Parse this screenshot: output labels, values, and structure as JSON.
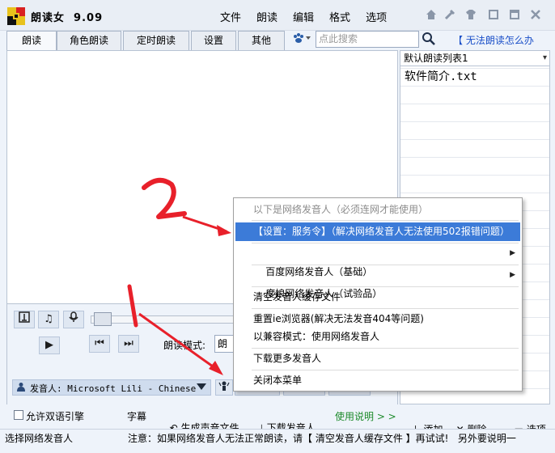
{
  "app": {
    "title": "朗读女  9.09"
  },
  "menu": [
    "文件",
    "朗读",
    "编辑",
    "格式",
    "选项"
  ],
  "window_buttons": [
    "home-icon",
    "tool-icon",
    "shirt-icon",
    "restore-icon",
    "minimize-icon",
    "close-icon"
  ],
  "tabs": [
    {
      "label": "朗读",
      "active": true
    },
    {
      "label": "角色朗读",
      "active": false
    },
    {
      "label": "定时朗读",
      "active": false
    },
    {
      "label": "设置",
      "active": false
    },
    {
      "label": "其他",
      "active": false
    }
  ],
  "search": {
    "placeholder": "点此搜索"
  },
  "help_link": "【 无法朗读怎么办",
  "playlist": {
    "selected": "默认朗读列表1",
    "files": [
      "软件简介.txt"
    ]
  },
  "controls": {
    "read_mode_label": "朗读模式:",
    "read_mode_value": "朗",
    "voice_label": "发音人: Microsoft Lili - Chinese",
    "allow_dual_engine": "允许双语引擎",
    "subtitle_btn": "字幕",
    "generate_audio": "生成声音文件",
    "download_voice": "下载发音人",
    "usage_guide": "使用说明 > >"
  },
  "list_footer": {
    "add": "添加",
    "delete": "删除",
    "options": "选项"
  },
  "context_menu": [
    {
      "label": "以下是网络发音人（必须连网才能使用）",
      "disabled": true
    },
    {
      "label": "【设置：服务令】（解决网络发音人无法使用502报错问题）",
      "highlight": true
    },
    {
      "label": "百度网络发音人（基础）",
      "submenu": true
    },
    {
      "label": "度娘网络发音人（试验品）",
      "submenu": true
    },
    {
      "label": "清空发音人缓存文件"
    },
    {
      "label": "重置ie浏览器(解决无法发音404等问题)"
    },
    {
      "label": "以兼容模式：使用网络发音人"
    },
    {
      "label": "下载更多发音人"
    },
    {
      "label": "关闭本菜单"
    }
  ],
  "status": {
    "left": "选择网络发音人",
    "right": "注意：如果网络发音人无法正常朗读，请【 清空发音人缓存文件 】再试试!   另外要说明一"
  },
  "annotations": {
    "arrow1": "1",
    "arrow2": "2"
  },
  "colors": {
    "highlight": "#3c7bd8",
    "link": "#1a4fc8",
    "annotation": "#e8202a",
    "green_link": "#1c8a2a"
  }
}
